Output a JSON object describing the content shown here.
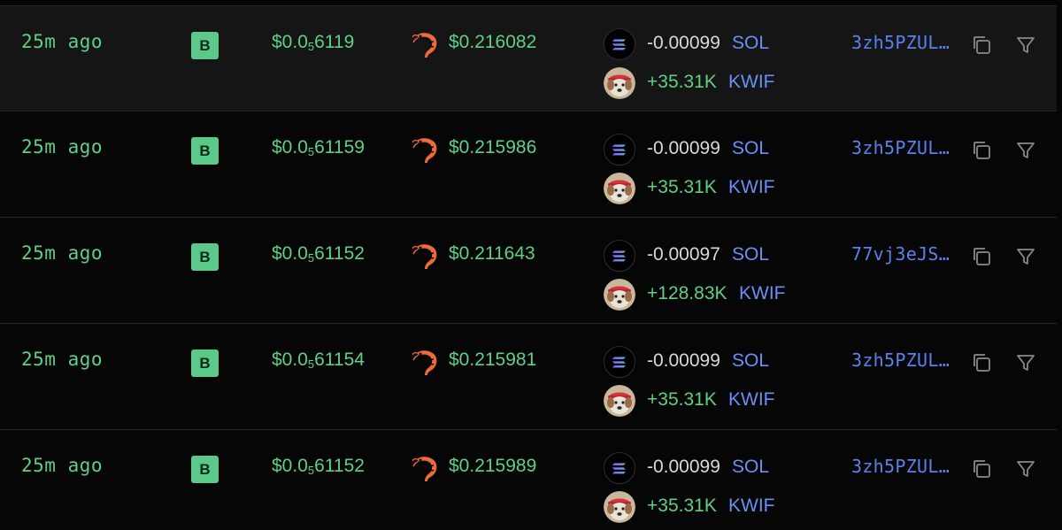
{
  "colors": {
    "background": "#060606",
    "row_highlight": "#151515",
    "buy_green": "#5fcf86",
    "badge_green": "#5bc98a",
    "link_blue": "#5a82ee",
    "symbol_blue": "#6a8ff7",
    "shrimp_orange": "#ef6a3a"
  },
  "icons": {
    "tier": "shrimp-icon",
    "base_token": "solana-icon",
    "quote_token": "kwif-dog-icon",
    "copy": "copy-icon",
    "filter": "filter-icon"
  },
  "trades": [
    {
      "age": "25m ago",
      "type": "B",
      "price_prefix": "$0.0",
      "price_zeros": "5",
      "price_digits": "6119",
      "usd": "$0.216082",
      "sol_amount": "-0.00099",
      "sol_symbol": "SOL",
      "token_amount": "+35.31K",
      "token_symbol": "KWIF",
      "maker": "3zh5PZUL…"
    },
    {
      "age": "25m ago",
      "type": "B",
      "price_prefix": "$0.0",
      "price_zeros": "5",
      "price_digits": "61159",
      "usd": "$0.215986",
      "sol_amount": "-0.00099",
      "sol_symbol": "SOL",
      "token_amount": "+35.31K",
      "token_symbol": "KWIF",
      "maker": "3zh5PZUL…"
    },
    {
      "age": "25m ago",
      "type": "B",
      "price_prefix": "$0.0",
      "price_zeros": "5",
      "price_digits": "61152",
      "usd": "$0.211643",
      "sol_amount": "-0.00097",
      "sol_symbol": "SOL",
      "token_amount": "+128.83K",
      "token_symbol": "KWIF",
      "maker": "77vj3eJS…"
    },
    {
      "age": "25m ago",
      "type": "B",
      "price_prefix": "$0.0",
      "price_zeros": "5",
      "price_digits": "61154",
      "usd": "$0.215981",
      "sol_amount": "-0.00099",
      "sol_symbol": "SOL",
      "token_amount": "+35.31K",
      "token_symbol": "KWIF",
      "maker": "3zh5PZUL…"
    },
    {
      "age": "25m ago",
      "type": "B",
      "price_prefix": "$0.0",
      "price_zeros": "5",
      "price_digits": "61152",
      "usd": "$0.215989",
      "sol_amount": "-0.00099",
      "sol_symbol": "SOL",
      "token_amount": "+35.31K",
      "token_symbol": "KWIF",
      "maker": "3zh5PZUL…"
    }
  ]
}
